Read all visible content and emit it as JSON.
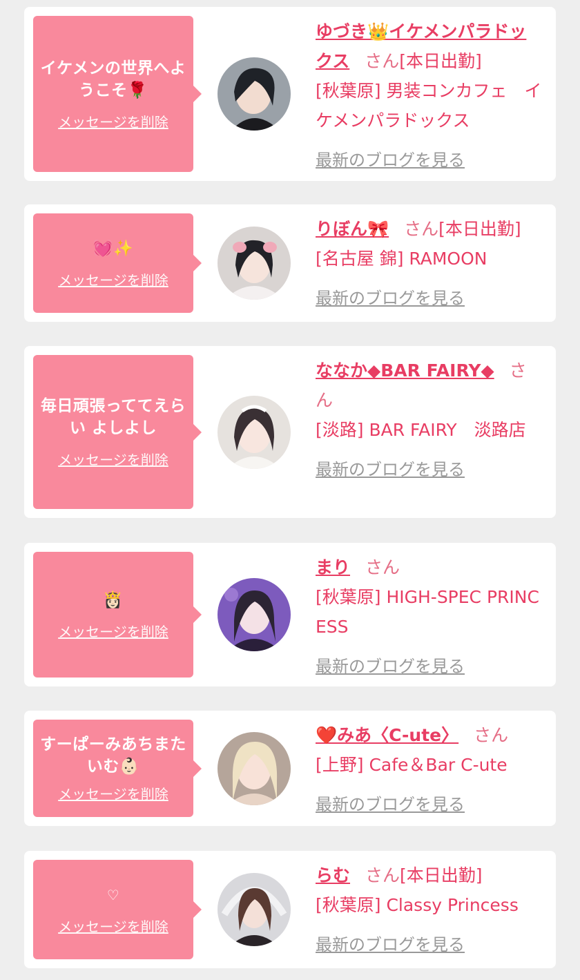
{
  "colors": {
    "page_background": "#eeeeee",
    "card_background": "#ffffff",
    "bubble_pink": "#f9899c",
    "accent_pink": "#e83d63",
    "link_gray": "#999999"
  },
  "delete_label": "メッセージを削除",
  "blog_label": "最新のブログを見る",
  "san_label": "さん",
  "cards": [
    {
      "message": "イケメンの世界へようこそ🌹",
      "name": "ゆづき👑イケメンパラドックス",
      "status": "[本日出勤]",
      "shop": "[秋葉原] 男装コンカフェ　イケメンパラドックス"
    },
    {
      "message": "💓✨",
      "name": "りぼん🎀",
      "status": "[本日出勤]",
      "shop": "[名古屋 錦] RAMOON"
    },
    {
      "message": "毎日頑張っててえらい よしよし",
      "name": "ななか◆BAR FAIRY◆",
      "status": "",
      "shop": "[淡路] BAR FAIRY　淡路店"
    },
    {
      "message": "👸🏻",
      "name": "まり",
      "status": "",
      "shop": "[秋葉原] HIGH-SPEC PRINCESS"
    },
    {
      "message": "すーぱーみあちまたいむ👶🏻",
      "name": "❤️みあ〈C-ute〉",
      "status": "",
      "shop": "[上野] Cafe＆Bar C-ute"
    },
    {
      "message": "♡",
      "name": "らむ",
      "status": "[本日出勤]",
      "shop": "[秋葉原] Classy Princess"
    }
  ]
}
